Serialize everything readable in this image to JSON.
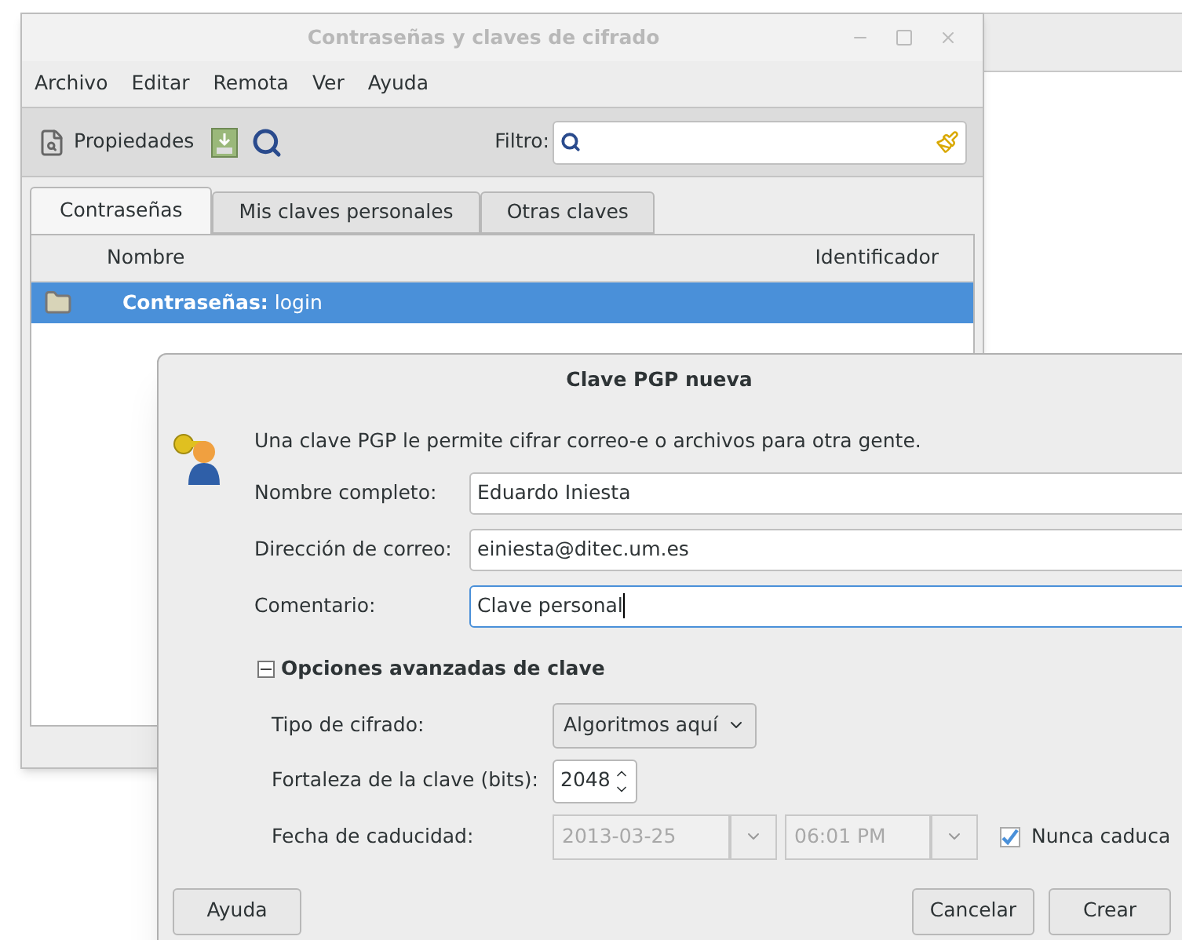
{
  "main_window": {
    "title": "Contraseñas y claves de cifrado",
    "menu": [
      "Archivo",
      "Editar",
      "Remota",
      "Ver",
      "Ayuda"
    ],
    "toolbar": {
      "properties_button": "Propiedades",
      "filter_label": "Filtro:"
    },
    "tabs": [
      {
        "label": "Contraseñas",
        "selected": true
      },
      {
        "label": "Mis claves personales",
        "selected": false
      },
      {
        "label": "Otras claves",
        "selected": false
      }
    ],
    "list": {
      "columns": [
        "Nombre",
        "Identificador"
      ],
      "rows": [
        {
          "name": "**Contraseñas:** login",
          "selected": true
        }
      ]
    }
  },
  "dialog": {
    "title": "Clave PGP nueva",
    "intro": "Una clave PGP le permite cifrar correo-e o archivos para otra gente.",
    "fields": [
      {
        "label": "Nombre completo:",
        "value": "Eduardo Iniesta",
        "focused": false
      },
      {
        "label": "Dirección de correo:",
        "value": "einiesta@ditec.um.es",
        "focused": false
      },
      {
        "label": "Comentario:",
        "value": "Clave personal",
        "focused": true
      }
    ],
    "advanced": {
      "label": "Opciones avanzadas de clave",
      "expanded": true
    },
    "encryption": {
      "label": "Tipo de cifrado:",
      "value": "Algoritmos aquí"
    },
    "strength": {
      "label": "Fortaleza de la clave (bits):",
      "value": "2048"
    },
    "expiry": {
      "label": "Fecha de caducidad:",
      "date": "2013-03-25",
      "time": "06:01 PM",
      "disabled": true
    },
    "never_expires": {
      "label": "Nunca caduca",
      "checked": true
    },
    "buttons": {
      "help": "Ayuda",
      "cancel": "Cancelar",
      "create": "Crear"
    }
  }
}
